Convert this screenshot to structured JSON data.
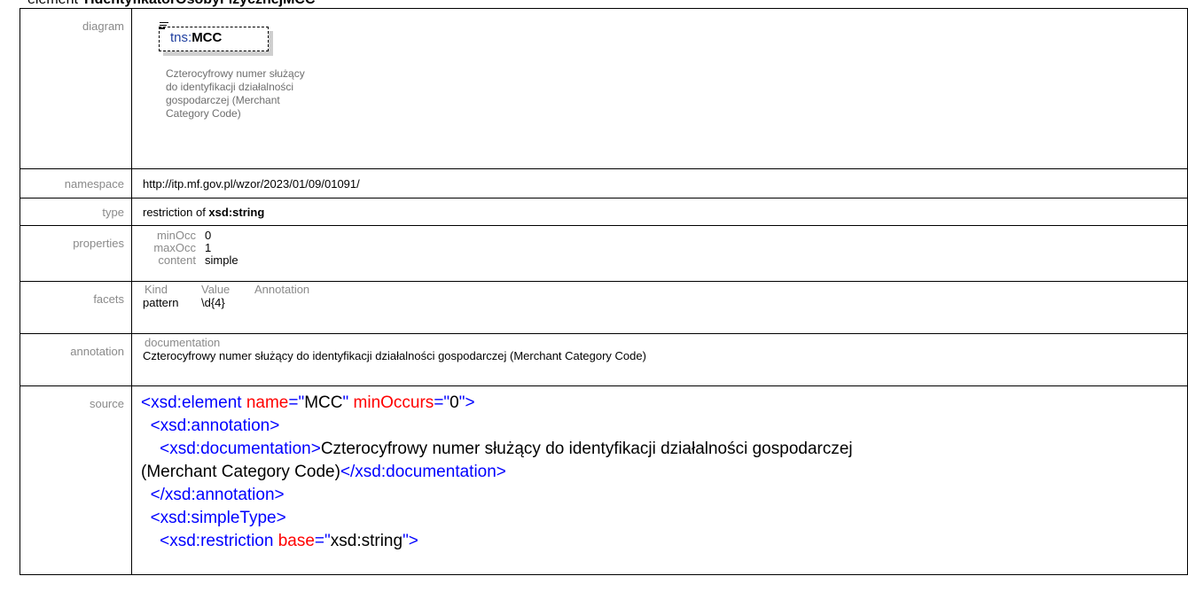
{
  "header": {
    "prefix": "element",
    "name": "TIdentyfikatorOsobyFizycznejMCC"
  },
  "rows": {
    "diagram": {
      "label": "diagram",
      "prefix": "tns:",
      "name": "MCC",
      "doc": [
        "Czterocyfrowy numer służący",
        "do identyfikacji działalności",
        "gospodarczej (Merchant",
        "Category Code)"
      ]
    },
    "namespace": {
      "label": "namespace",
      "value": "http://itp.mf.gov.pl/wzor/2023/01/09/01091/"
    },
    "type": {
      "label": "type",
      "prefix": "restriction of ",
      "base": "xsd:string"
    },
    "properties": {
      "label": "properties",
      "items": [
        {
          "key": "minOcc",
          "value": "0"
        },
        {
          "key": "maxOcc",
          "value": "1"
        },
        {
          "key": "content",
          "value": "simple"
        }
      ]
    },
    "facets": {
      "label": "facets",
      "headers": [
        "Kind",
        "Value",
        "Annotation"
      ],
      "rows": [
        {
          "kind": "pattern",
          "value": "\\d{4}"
        }
      ]
    },
    "annotation": {
      "label": "annotation",
      "head": "documentation",
      "text": "Czterocyfrowy numer służący do identyfikacji działalności gospodarczej (Merchant Category Code)"
    },
    "source": {
      "label": "source",
      "line1_tag": "<xsd:element",
      "line1_attr1": "name",
      "line1_val1": "MCC",
      "line1_attr2": "minOccurs",
      "line1_val2": "0",
      "line2": "<xsd:annotation>",
      "line3_open": "<xsd:documentation>",
      "line3_text": "Czterocyfrowy numer służący do identyfikacji działalności gospodarczej",
      "line4_text": "(Merchant Category Code)",
      "line4_close": "</xsd:documentation>",
      "line5": "</xsd:annotation>",
      "line6": "<xsd:simpleType>",
      "line7_tag": "<xsd:restriction",
      "line7_attr": "base",
      "line7_val": "xsd:string"
    }
  },
  "colors": {
    "tag": "#0000ff",
    "attr": "#ff0000",
    "label": "#8a8a8a"
  }
}
